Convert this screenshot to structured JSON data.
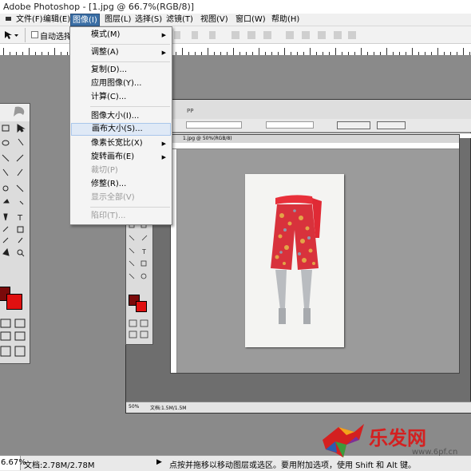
{
  "app": {
    "title": "Adobe Photoshop - [1.jpg @ 66.7%(RGB/8)]"
  },
  "menubar": {
    "items": [
      {
        "label": "文件(F)"
      },
      {
        "label": "编辑(E)"
      },
      {
        "label": "图像(I)",
        "active": true
      },
      {
        "label": "图层(L)"
      },
      {
        "label": "选择(S)"
      },
      {
        "label": "滤镜(T)"
      },
      {
        "label": "视图(V)"
      },
      {
        "label": "窗口(W)"
      },
      {
        "label": "帮助(H)"
      }
    ]
  },
  "optionsbar": {
    "auto_select_label": "自动选择"
  },
  "image_menu": {
    "items": [
      {
        "label": "模式(M)",
        "submenu": true
      },
      {
        "label": "调整(A)",
        "submenu": true
      },
      {
        "label": "复制(D)..."
      },
      {
        "label": "应用图像(Y)..."
      },
      {
        "label": "计算(C)..."
      },
      {
        "label": "图像大小(I)..."
      },
      {
        "label": "画布大小(S)...",
        "hover": true
      },
      {
        "label": "像素长宽比(X)",
        "submenu": true
      },
      {
        "label": "旋转画布(E)",
        "submenu": true
      },
      {
        "label": "裁切(P)",
        "disabled": true
      },
      {
        "label": "修整(R)..."
      },
      {
        "label": "显示全部(V)",
        "disabled": true
      },
      {
        "label": "陷印(T)...",
        "disabled": true
      }
    ]
  },
  "doc": {
    "title": "1.jpg @ 50%(RGB/8)"
  },
  "nested": {
    "title_fragment": "PP",
    "status_left": "50%",
    "status_doc": "文档:1.5M/1.5M"
  },
  "status": {
    "zoom": "6.67%",
    "doc_info": "文档:2.78M/2.78M",
    "hint": "点按并拖移以移动图层或选区。要用附加选项，使用 Shift 和 Alt 键。"
  },
  "watermark": {
    "text": "乐发网",
    "url": "www.6pf.cn"
  },
  "colors": {
    "foreground": "#7a0a0a",
    "background": "#e01010",
    "menu_highlight": "#3a6ea5",
    "watermark_red": "#d42020"
  },
  "icons": [
    "move-icon",
    "marquee-icon",
    "lasso-icon",
    "magic-wand-icon",
    "crop-icon",
    "brush-icon",
    "stamp-icon",
    "eraser-icon",
    "gradient-icon",
    "pen-icon",
    "text-icon",
    "shape-icon",
    "eyedropper-icon",
    "hand-icon",
    "zoom-icon",
    "submenu-arrow-icon"
  ]
}
